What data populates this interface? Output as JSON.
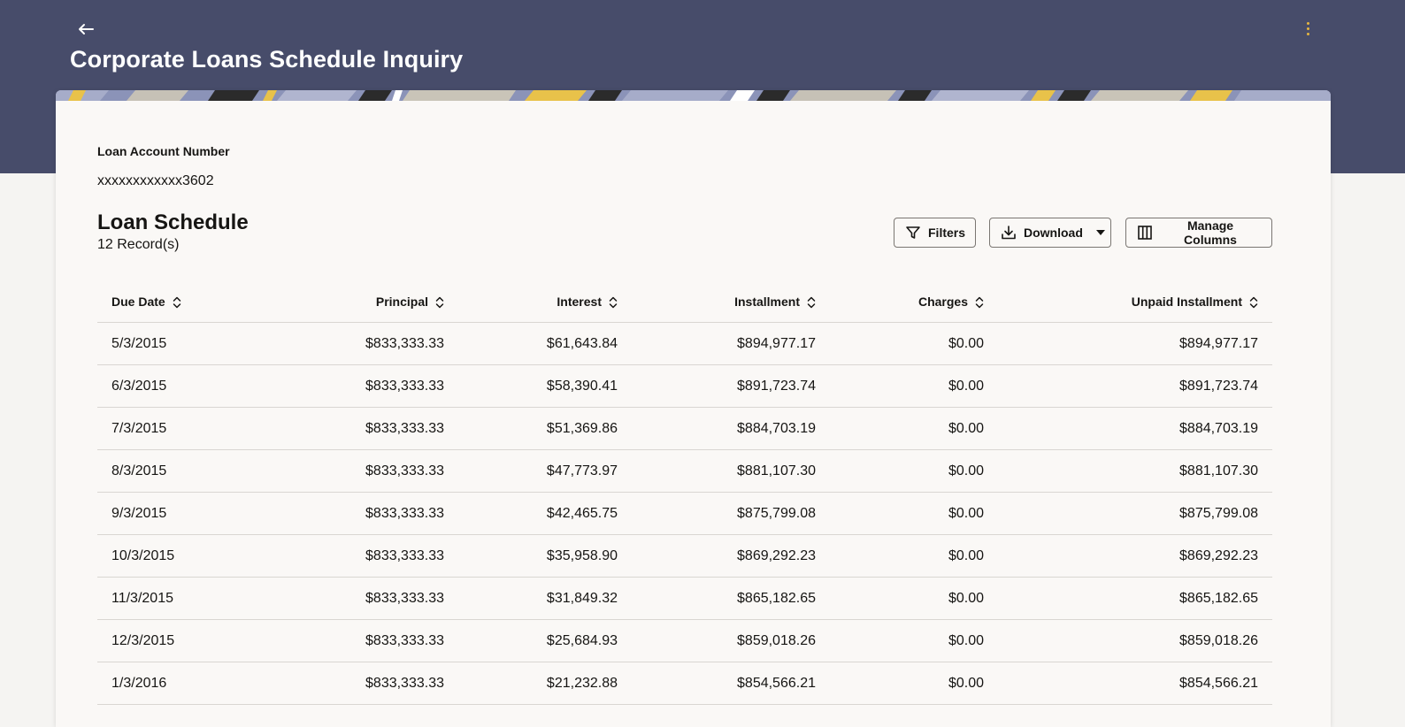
{
  "header": {
    "title": "Corporate Loans Schedule Inquiry",
    "back_icon": "back-arrow-icon",
    "menu_icon": "kebab-menu-icon"
  },
  "colors": {
    "header_bg": "#474c6a",
    "card_bg": "#faf8f6",
    "page_bg": "#f5f4f2",
    "accent": "#e6b640"
  },
  "account": {
    "label": "Loan Account Number",
    "value": "xxxxxxxxxxxx3602"
  },
  "schedule": {
    "title": "Loan Schedule",
    "record_count": "12 Record(s)",
    "toolbar": {
      "filters_label": "Filters",
      "download_label": "Download",
      "manage_columns_label": "Manage Columns"
    },
    "columns": [
      "Due Date",
      "Principal",
      "Interest",
      "Installment",
      "Charges",
      "Unpaid Installment"
    ],
    "rows": [
      [
        "5/3/2015",
        "$833,333.33",
        "$61,643.84",
        "$894,977.17",
        "$0.00",
        "$894,977.17"
      ],
      [
        "6/3/2015",
        "$833,333.33",
        "$58,390.41",
        "$891,723.74",
        "$0.00",
        "$891,723.74"
      ],
      [
        "7/3/2015",
        "$833,333.33",
        "$51,369.86",
        "$884,703.19",
        "$0.00",
        "$884,703.19"
      ],
      [
        "8/3/2015",
        "$833,333.33",
        "$47,773.97",
        "$881,107.30",
        "$0.00",
        "$881,107.30"
      ],
      [
        "9/3/2015",
        "$833,333.33",
        "$42,465.75",
        "$875,799.08",
        "$0.00",
        "$875,799.08"
      ],
      [
        "10/3/2015",
        "$833,333.33",
        "$35,958.90",
        "$869,292.23",
        "$0.00",
        "$869,292.23"
      ],
      [
        "11/3/2015",
        "$833,333.33",
        "$31,849.32",
        "$865,182.65",
        "$0.00",
        "$865,182.65"
      ],
      [
        "12/3/2015",
        "$833,333.33",
        "$25,684.93",
        "$859,018.26",
        "$0.00",
        "$859,018.26"
      ],
      [
        "1/3/2016",
        "$833,333.33",
        "$21,232.88",
        "$854,566.21",
        "$0.00",
        "$854,566.21"
      ]
    ]
  }
}
